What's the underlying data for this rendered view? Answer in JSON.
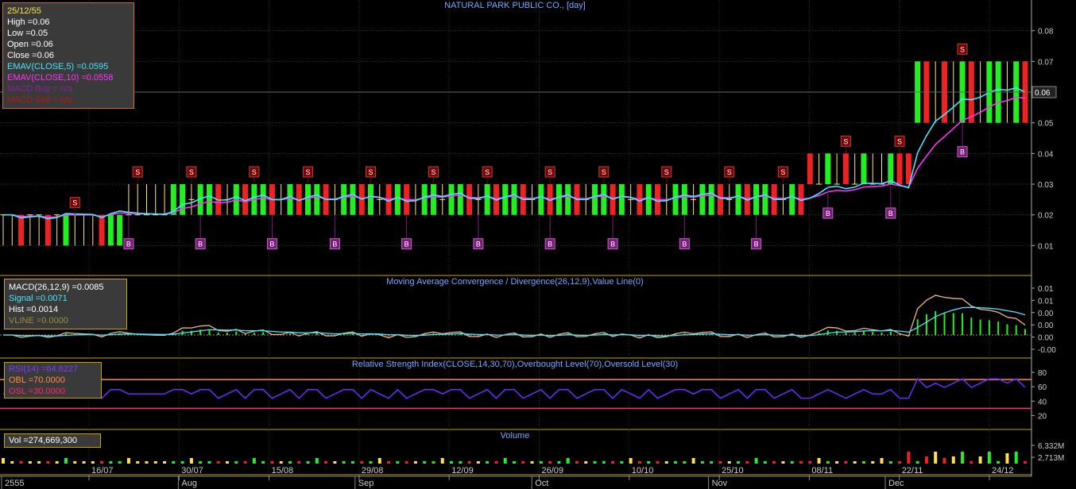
{
  "chart_title": "NATURAL PARK PUBLIC CO., [day]",
  "current_price_label": "0.06",
  "info_price": {
    "date": "25/12/55",
    "lines": [
      {
        "text": "High  =0.06",
        "color": "#ffffff"
      },
      {
        "text": "Low  =0.05",
        "color": "#ffffff"
      },
      {
        "text": "Open  =0.06",
        "color": "#ffffff"
      },
      {
        "text": "Close  =0.06",
        "color": "#ffffff"
      },
      {
        "text": "EMAV(CLOSE,5)   =0.0595",
        "color": "#44e6ff"
      },
      {
        "text": "EMAV(CLOSE,10)   =0.0558",
        "color": "#ff33ff"
      },
      {
        "text": "MACD Buy  = n/a",
        "color": "#8a1fa0"
      },
      {
        "text": "MACD Sell  = n/a",
        "color": "#b01a1a"
      }
    ]
  },
  "info_macd": {
    "lines": [
      {
        "text": "MACD(26,12,9)   =0.0085",
        "color": "#ffffff"
      },
      {
        "text": "Signal  =0.0071",
        "color": "#44e6ff"
      },
      {
        "text": "Hist  =0.0014",
        "color": "#ffffff"
      },
      {
        "text": "VLINE   =0.0000",
        "color": "#9a8f3a"
      }
    ]
  },
  "info_rsi": {
    "lines": [
      {
        "text": "RSI(14)   =64.6227",
        "color": "#7a3cff"
      },
      {
        "text": "OBL   =70.0000",
        "color": "#ff8a40"
      },
      {
        "text": "OSL   =30.0000",
        "color": "#ff2a6a"
      }
    ]
  },
  "info_vol": {
    "lines": [
      {
        "text": "Vol   =274,669,300",
        "color": "#ffffff"
      }
    ]
  },
  "panel_titles": {
    "macd": "Moving Average Convergence / Divergence(26,12,9),Value Line(0)",
    "rsi": "Relative Strength Index(CLOSE,14,30,70),Overbought Level(70),Oversold Level(30)",
    "volume": "Volume"
  },
  "colors": {
    "up": "#22ee22",
    "down": "#ee2222",
    "ema5": "#44e6ff",
    "ema10": "#ff33ff",
    "macd": "#f2b48a",
    "signal": "#44e6ff",
    "rsi": "#6a2bff",
    "obl": "#ff8a40",
    "osl": "#ff2a6a",
    "panel_border": "#c8a400",
    "signal_S": "#7a0000",
    "signal_B": "#7a1a7a"
  },
  "chart_data": [
    {
      "type": "candlestick",
      "title": "NATURAL PARK PUBLIC CO., [day]",
      "ylim": [
        0.0,
        0.09
      ],
      "y_ticks": [
        "0.01",
        "0.02",
        "0.03",
        "0.04",
        "0.05",
        "0.06",
        "0.07",
        "0.08"
      ],
      "x_ticks": [
        "16/07",
        "30/07",
        "15/08",
        "29/08",
        "12/09",
        "26/09",
        "10/10",
        "25/10",
        "08/11",
        "22/11",
        "24/12"
      ],
      "x_months": [
        "2555",
        "Aug",
        "Sep",
        "Oct",
        "Nov",
        "Dec"
      ],
      "segments": [
        {
          "price_from": 0.02,
          "price_to": 0.02,
          "hi": 0.02,
          "lo": 0.01,
          "count": 14,
          "pattern": [
            0,
            0,
            -1,
            0,
            0,
            -1,
            0,
            1,
            0,
            0,
            0,
            -1,
            1,
            1
          ]
        },
        {
          "price_from": 0.02,
          "price_to": 0.02,
          "hi": 0.03,
          "lo": 0.02,
          "count": 6,
          "pattern": [
            0,
            0,
            0,
            0,
            0,
            1
          ]
        },
        {
          "price_from": 0.025,
          "price_to": 0.025,
          "hi": 0.03,
          "lo": 0.02,
          "count": 70,
          "pattern": [
            1,
            0,
            1,
            1,
            -1,
            0,
            1,
            -1,
            1,
            1,
            -1,
            0,
            1,
            -1,
            1,
            1,
            -1,
            0,
            1,
            1,
            -1,
            1,
            0,
            -1,
            1,
            -1,
            0,
            1
          ]
        },
        {
          "price_from": 0.03,
          "price_to": 0.03,
          "hi": 0.04,
          "lo": 0.03,
          "count": 12,
          "pattern": [
            -1,
            0,
            1,
            0,
            -1,
            0,
            1,
            0,
            0,
            1,
            -1,
            -1
          ]
        },
        {
          "price_from": 0.06,
          "price_to": 0.06,
          "hi": 0.07,
          "lo": 0.05,
          "count": 13,
          "pattern": [
            1,
            -1,
            0,
            -1,
            0,
            1,
            -1,
            0,
            1,
            1,
            0,
            1,
            -1
          ]
        }
      ],
      "sell_signals": 16,
      "buy_signals": 13
    },
    {
      "type": "line",
      "title": "Moving Average Convergence / Divergence(26,12,9),Value Line(0)",
      "y_ticks": [
        "0.01",
        "0.01",
        "0.00",
        "0.00",
        "0.00",
        "-0.00"
      ],
      "series": [
        {
          "name": "MACD(26,12,9)",
          "last": 0.0085
        },
        {
          "name": "Signal",
          "last": 0.0071
        },
        {
          "name": "Hist",
          "last": 0.0014
        },
        {
          "name": "VLINE",
          "last": 0.0
        }
      ]
    },
    {
      "type": "line",
      "title": "Relative Strength Index(CLOSE,14,30,70),Overbought Level(70),Oversold Level(30)",
      "ylim": [
        5,
        90
      ],
      "y_ticks": [
        "20",
        "40",
        "60",
        "80"
      ],
      "series": [
        {
          "name": "RSI(14)",
          "last": 64.6227
        },
        {
          "name": "OBL",
          "last": 70.0
        },
        {
          "name": "OSL",
          "last": 30.0
        }
      ]
    },
    {
      "type": "bar",
      "title": "Volume",
      "y_ticks": [
        "2,713M",
        "6,332M"
      ],
      "series": [
        {
          "name": "Vol",
          "last": 274669300
        }
      ]
    }
  ]
}
